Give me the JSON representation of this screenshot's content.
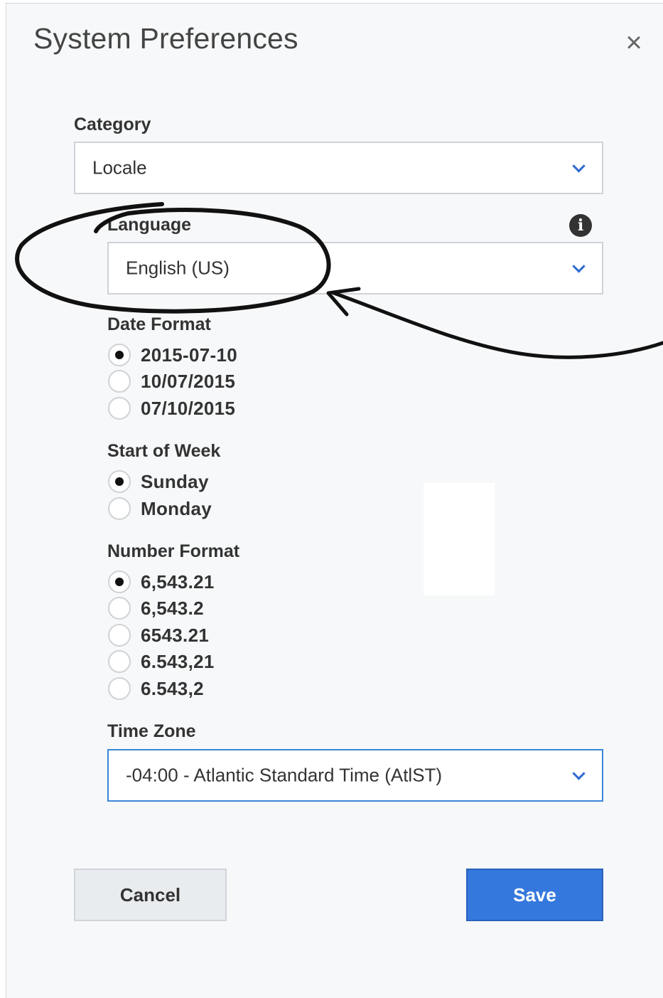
{
  "dialog": {
    "title": "System Preferences",
    "close_label": "×"
  },
  "category": {
    "label": "Category",
    "value": "Locale"
  },
  "language": {
    "label": "Language",
    "value": "English (US)",
    "info_icon": "i"
  },
  "date_format": {
    "label": "Date Format",
    "options": [
      "2015-07-10",
      "10/07/2015",
      "07/10/2015"
    ],
    "selected": "2015-07-10"
  },
  "start_of_week": {
    "label": "Start of Week",
    "options": [
      "Sunday",
      "Monday"
    ],
    "selected": "Sunday"
  },
  "number_format": {
    "label": "Number Format",
    "options": [
      "6,543.21",
      "6,543.2",
      "6543.21",
      "6.543,21",
      "6.543,2"
    ],
    "selected": "6,543.21"
  },
  "time_zone": {
    "label": "Time Zone",
    "value": "-04:00 - Atlantic Standard Time (AtlST)"
  },
  "buttons": {
    "cancel": "Cancel",
    "save": "Save"
  },
  "colors": {
    "accent": "#3578dd",
    "panel_background": "#f7f8f9",
    "chevron": "#2e6bd1"
  }
}
